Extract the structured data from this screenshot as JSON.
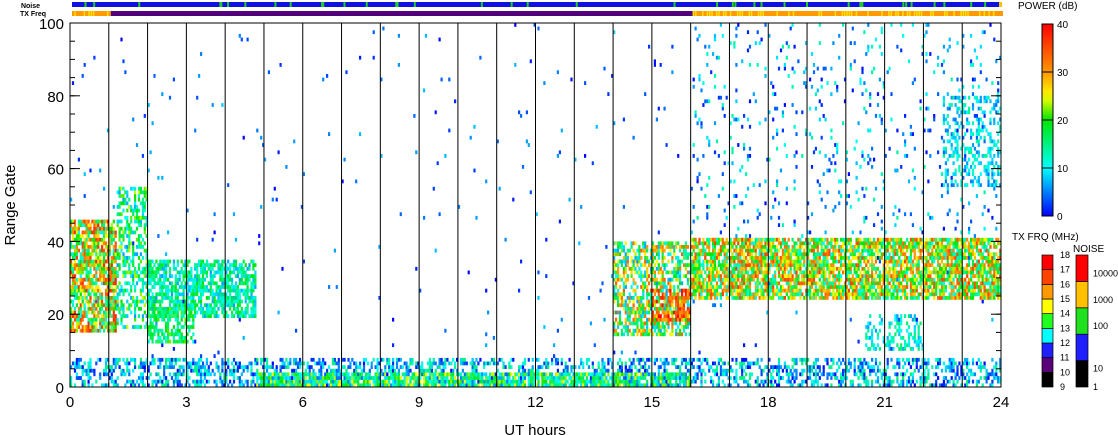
{
  "chart_data": {
    "type": "heatmap",
    "title": "",
    "xlabel": "UT hours",
    "ylabel": "Range Gate",
    "xlim": [
      0,
      24
    ],
    "ylim": [
      0,
      100
    ],
    "xticks": [
      "0",
      "3",
      "6",
      "9",
      "12",
      "15",
      "18",
      "21",
      "24"
    ],
    "yticks": [
      "0",
      "20",
      "40",
      "60",
      "80",
      "100"
    ],
    "top_bars": {
      "noise_label": "Noise",
      "txfreq_label": "TX Freq"
    },
    "power_colorbar": {
      "label": "POWER (dB)",
      "ticks": [
        "0",
        "10",
        "20",
        "30",
        "40"
      ],
      "range": [
        0,
        40
      ]
    },
    "txfreq_colorbar": {
      "label": "TX FRQ (MHz)",
      "ticks": [
        "9",
        "10",
        "11",
        "12",
        "13",
        "14",
        "15",
        "16",
        "17",
        "18"
      ],
      "colors": [
        "#000000",
        "#5a0078",
        "#2020ff",
        "#00ffff",
        "#20ff20",
        "#ffff00",
        "#ff9900",
        "#ff4400",
        "#ff0000"
      ]
    },
    "noise_colorbar": {
      "label": "NOISE",
      "ticks": [
        "1",
        "10",
        "100",
        "1000",
        "10000"
      ],
      "colors": [
        "#000000",
        "#2020ff",
        "#20e020",
        "#ffc000",
        "#ff0000"
      ]
    },
    "txfreq_segments": [
      {
        "t0": 0,
        "t1": 1,
        "freq": "14-15"
      },
      {
        "t0": 1,
        "t1": 16,
        "freq": "10-11"
      },
      {
        "t0": 16,
        "t1": 24,
        "freq": "14-15"
      }
    ],
    "echo_regions": [
      {
        "t0": 0,
        "t1": 1.2,
        "g0": 15,
        "g1": 46,
        "p0": 10,
        "p1": 38,
        "d": 0.8
      },
      {
        "t0": 1.2,
        "t1": 2,
        "g0": 16,
        "g1": 55,
        "p0": 6,
        "p1": 24,
        "d": 0.5
      },
      {
        "t0": 2,
        "t1": 4.8,
        "g0": 19,
        "g1": 35,
        "p0": 6,
        "p1": 20,
        "d": 0.7
      },
      {
        "t0": 2,
        "t1": 3.2,
        "g0": 12,
        "g1": 22,
        "p0": 10,
        "p1": 22,
        "d": 0.6
      },
      {
        "t0": 0,
        "t1": 24,
        "g0": 0,
        "g1": 8,
        "p0": 0,
        "p1": 16,
        "d": 0.45
      },
      {
        "t0": 4.8,
        "t1": 16,
        "g0": 0,
        "g1": 4,
        "p0": 4,
        "p1": 26,
        "d": 0.8
      },
      {
        "t0": 14,
        "t1": 16,
        "g0": 14,
        "g1": 40,
        "p0": 6,
        "p1": 34,
        "d": 0.6
      },
      {
        "t0": 15,
        "t1": 16,
        "g0": 18,
        "g1": 27,
        "p0": 28,
        "p1": 40,
        "d": 0.6
      },
      {
        "t0": 16,
        "t1": 24,
        "g0": 24,
        "g1": 41,
        "p0": 10,
        "p1": 36,
        "d": 0.8
      },
      {
        "t0": 16,
        "t1": 24,
        "g0": 41,
        "g1": 100,
        "p0": 0,
        "p1": 14,
        "d": 0.05
      },
      {
        "t0": 20.5,
        "t1": 22,
        "g0": 10,
        "g1": 20,
        "p0": 6,
        "p1": 16,
        "d": 0.35
      },
      {
        "t0": 22.5,
        "t1": 24,
        "g0": 55,
        "g1": 80,
        "p0": 4,
        "p1": 14,
        "d": 0.3
      },
      {
        "t0": 0,
        "t1": 24,
        "g0": 0,
        "g1": 100,
        "p0": 0,
        "p1": 8,
        "d": 0.008
      }
    ]
  }
}
